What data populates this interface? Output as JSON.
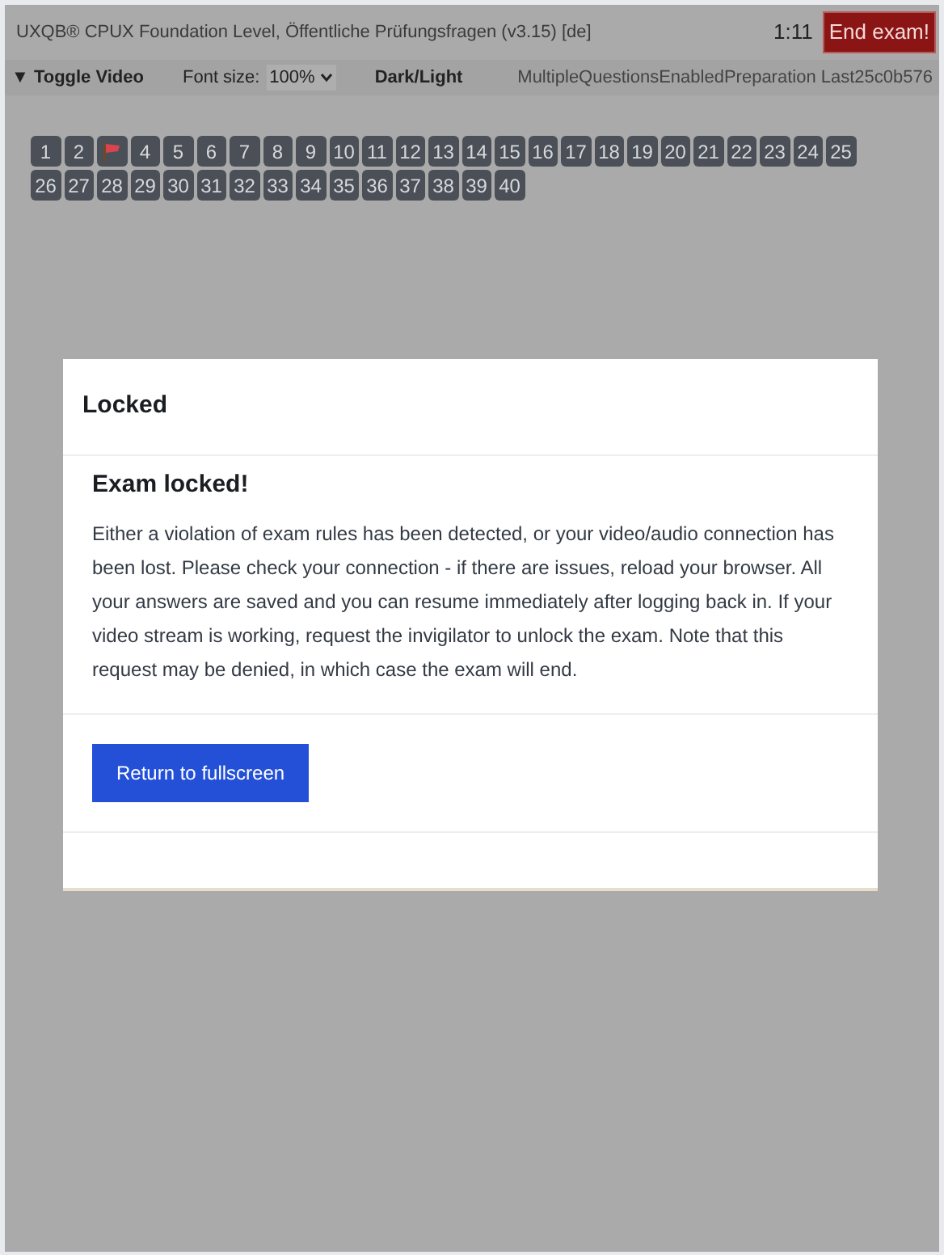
{
  "header": {
    "title": "UXQB® CPUX Foundation Level, Öffentliche Prüfungsfragen (v3.15) [de]",
    "timer": "1:11",
    "end_button": "End exam!"
  },
  "toolbar": {
    "toggle_video": "▼ Toggle Video",
    "font_size_label": "Font size:",
    "font_size_value": "100%",
    "theme_toggle": "Dark/Light",
    "session_info": "MultipleQuestionsEnabledPreparation Last25c0b576"
  },
  "questions": [
    {
      "kind": "number",
      "label": "1"
    },
    {
      "kind": "number",
      "label": "2"
    },
    {
      "kind": "flagged"
    },
    {
      "kind": "number",
      "label": "4"
    },
    {
      "kind": "number",
      "label": "5"
    },
    {
      "kind": "number",
      "label": "6"
    },
    {
      "kind": "number",
      "label": "7"
    },
    {
      "kind": "number",
      "label": "8"
    },
    {
      "kind": "number",
      "label": "9"
    },
    {
      "kind": "number",
      "label": "10"
    },
    {
      "kind": "number",
      "label": "11"
    },
    {
      "kind": "number",
      "label": "12"
    },
    {
      "kind": "number",
      "label": "13"
    },
    {
      "kind": "number",
      "label": "14"
    },
    {
      "kind": "number",
      "label": "15"
    },
    {
      "kind": "number",
      "label": "16"
    },
    {
      "kind": "number",
      "label": "17"
    },
    {
      "kind": "number",
      "label": "18"
    },
    {
      "kind": "number",
      "label": "19"
    },
    {
      "kind": "number",
      "label": "20"
    },
    {
      "kind": "number",
      "label": "21"
    },
    {
      "kind": "number",
      "label": "22"
    },
    {
      "kind": "number",
      "label": "23"
    },
    {
      "kind": "number",
      "label": "24"
    },
    {
      "kind": "number",
      "label": "25"
    },
    {
      "kind": "number",
      "label": "26"
    },
    {
      "kind": "number",
      "label": "27"
    },
    {
      "kind": "number",
      "label": "28"
    },
    {
      "kind": "number",
      "label": "29"
    },
    {
      "kind": "number",
      "label": "30"
    },
    {
      "kind": "number",
      "label": "31"
    },
    {
      "kind": "number",
      "label": "32"
    },
    {
      "kind": "number",
      "label": "33"
    },
    {
      "kind": "number",
      "label": "34"
    },
    {
      "kind": "number",
      "label": "35"
    },
    {
      "kind": "number",
      "label": "36"
    },
    {
      "kind": "number",
      "label": "37"
    },
    {
      "kind": "number",
      "label": "38"
    },
    {
      "kind": "number",
      "label": "39"
    },
    {
      "kind": "number",
      "label": "40"
    }
  ],
  "dialog": {
    "title": "Locked",
    "heading": "Exam locked!",
    "message": "Either a violation of exam rules has been detected, or your video/audio connection has been lost. Please check your connection - if there are issues, reload your browser. All your answers are saved and you can resume immediately after logging back in. If your video stream is working, request the invigilator to unlock the exam. Note that this request may be denied, in which case the exam will end.",
    "button": "Return to fullscreen"
  }
}
